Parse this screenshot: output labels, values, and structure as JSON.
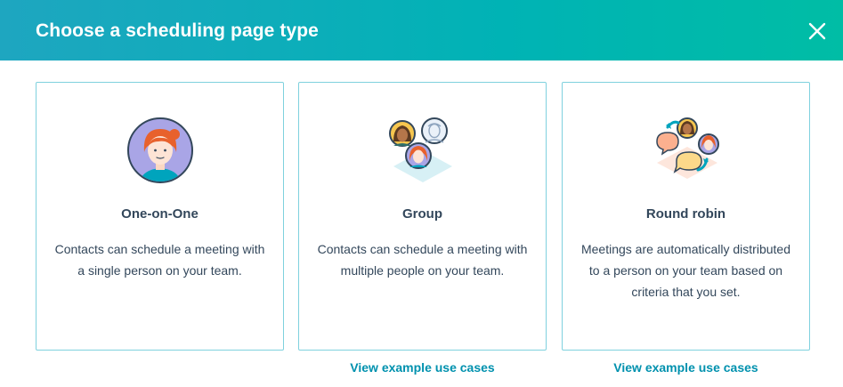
{
  "dialog": {
    "title": "Choose a scheduling page type",
    "close_icon": "close-icon"
  },
  "cards": [
    {
      "title": "One-on-One",
      "description": "Contacts can schedule a meeting with a single person on your team.",
      "illustration": "single-person-avatar-icon"
    },
    {
      "title": "Group",
      "description": "Contacts can schedule a meeting with multiple people on your team.",
      "illustration": "group-avatars-icon",
      "link": "View example use cases"
    },
    {
      "title": "Round robin",
      "description": "Meetings are automatically distributed to a person on your team based on criteria that you set.",
      "illustration": "round-robin-icon",
      "link": "View example use cases"
    }
  ],
  "colors": {
    "header_gradient_start": "#1ea6c0",
    "header_gradient_end": "#00bda5",
    "card_border": "#7fd1de",
    "link": "#0091ae",
    "text": "#33475b"
  }
}
